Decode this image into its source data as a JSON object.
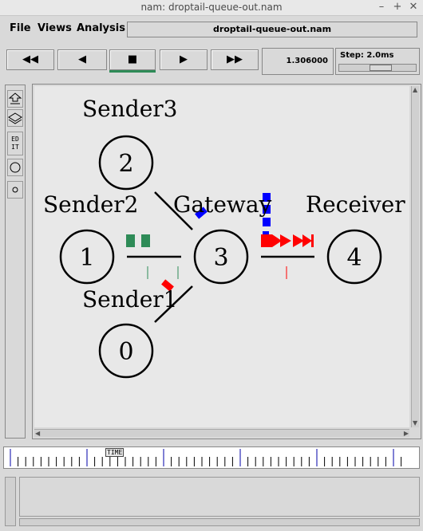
{
  "window": {
    "title": "nam: droptail-queue-out.nam",
    "buttons": {
      "minimize": "–",
      "maximize": "+",
      "close": "✕"
    }
  },
  "menu": {
    "file": "File",
    "views": "Views",
    "analysis": "Analysis",
    "filename": "droptail-queue-out.nam"
  },
  "controls": {
    "rewind": "◀◀",
    "back": "◀",
    "stop": "■",
    "play": "▶",
    "fastforward": "▶▶",
    "time": "1.306000",
    "step_label": "Step: 2.0ms"
  },
  "tools": {
    "edit": "ED\nIT"
  },
  "network": {
    "nodes": [
      {
        "id": "0",
        "label": "Sender1"
      },
      {
        "id": "1",
        "label": "Sender2"
      },
      {
        "id": "2",
        "label": "Sender3"
      },
      {
        "id": "3",
        "label": "Gateway"
      },
      {
        "id": "4",
        "label": "Receiver"
      }
    ],
    "colors": {
      "queue_a": "#2e8b57",
      "queue_b": "#ff0000",
      "blue": "#0000ff",
      "red": "#ff0000",
      "node_border": "#000000"
    }
  },
  "timeline": {
    "label": "TIME"
  }
}
